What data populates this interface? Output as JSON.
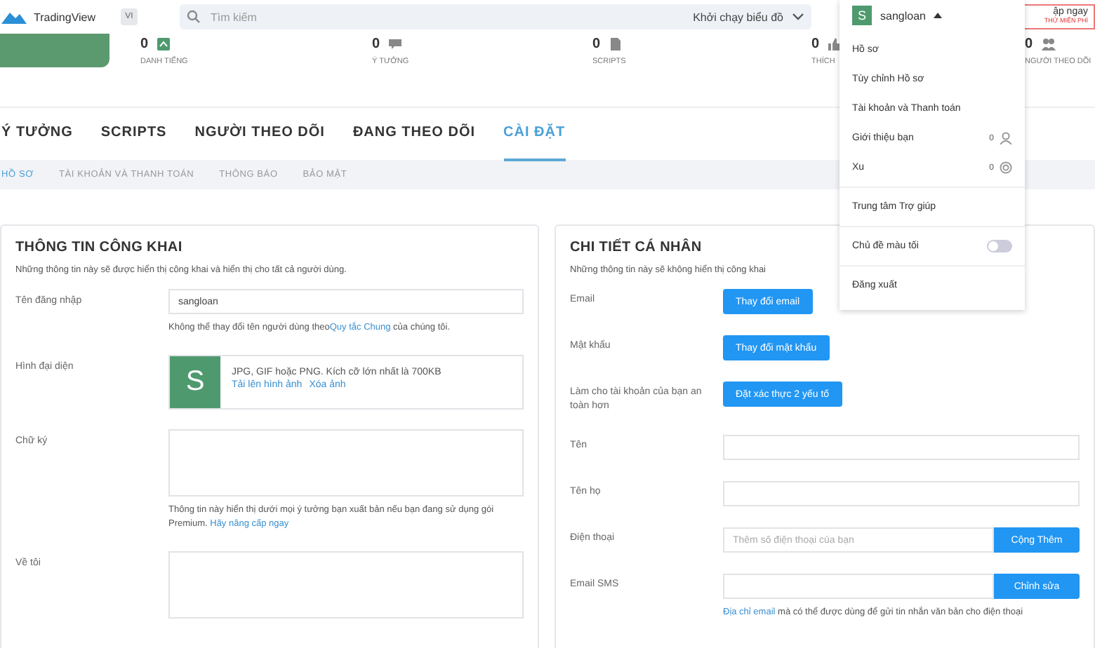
{
  "header": {
    "logo": "TradingView",
    "language": "VI",
    "search_placeholder": "Tìm kiếm",
    "launch_button": "Khởi chạy biểu đồ",
    "upgrade": {
      "label": "ập ngay",
      "sub": "THỬ MIỄN PHÍ"
    }
  },
  "stats": [
    {
      "value": "0",
      "label": "DANH TIẾNG"
    },
    {
      "value": "0",
      "label": "Ý TƯỞNG"
    },
    {
      "value": "0",
      "label": "SCRIPTS"
    },
    {
      "value": "0",
      "label": "THÍCH"
    },
    {
      "value": "0",
      "label": "NGƯỜI THEO DÕI"
    }
  ],
  "tabs": [
    {
      "label": "Ý TƯỞNG",
      "selected": false
    },
    {
      "label": "SCRIPTS",
      "selected": false
    },
    {
      "label": "NGƯỜI THEO DÕI",
      "selected": false
    },
    {
      "label": "ĐANG THEO DÕI",
      "selected": false
    },
    {
      "label": "CÀI ĐẶT",
      "selected": true
    }
  ],
  "subtabs": [
    {
      "label": "HỒ SƠ",
      "selected": true
    },
    {
      "label": "TÀI KHOẢN VÀ THANH TOÁN",
      "selected": false
    },
    {
      "label": "THÔNG BÁO",
      "selected": false
    },
    {
      "label": "BẢO MẬT",
      "selected": false
    }
  ],
  "public_info": {
    "title": "THÔNG TIN CÔNG KHAI",
    "description": "Những thông tin này sẽ được hiển thị công khai và hiển thị cho tất cả người dùng.",
    "username": {
      "label": "Tên đăng nhập",
      "value": "sangloan",
      "hint_before": "Không thể thay đổi tên người dùng theo",
      "hint_link": "Quy tắc Chung",
      "hint_after": " của chúng tôi."
    },
    "avatar": {
      "label": "Hình đại diện",
      "initial": "S",
      "note": "JPG, GIF hoặc PNG. Kích cỡ lớn nhất là 700KB",
      "upload_link": "Tải lên hình ảnh",
      "delete_link": "Xóa ảnh"
    },
    "signature": {
      "label": "Chữ ký",
      "hint": "Thông tin này hiển thị dưới mọi ý tưởng bạn xuất bản nếu bạn đang sử dụng gói Premium.",
      "hint_link": "Hãy nâng cấp ngay"
    },
    "about": {
      "label": "Về tôi"
    }
  },
  "personal": {
    "title": "CHI TIẾT CÁ NHÂN",
    "description": "Những thông tin này sẽ không hiển thị công khai",
    "rows": [
      {
        "kind": "button",
        "label": "Email",
        "button": "Thay đổi email"
      },
      {
        "kind": "button",
        "label": "Mật khẩu",
        "button": "Thay đổi mật khẩu"
      },
      {
        "kind": "button",
        "label": "Làm cho tài khoản của bạn an toàn hơn",
        "button": "Đặt xác thực 2 yếu tố"
      },
      {
        "kind": "input",
        "label": "Tên"
      },
      {
        "kind": "input",
        "label": "Tên họ"
      },
      {
        "kind": "input_button",
        "label": "Điện thoại",
        "placeholder": "Thêm số điện thoại của bạn",
        "button": "Cộng Thêm"
      },
      {
        "kind": "input_button",
        "label": "Email SMS",
        "button": "Chỉnh sửa",
        "hint_link": "Địa chỉ email",
        "hint": " mà có thể được dùng để gửi tin nhắn văn bản cho điện thoại"
      }
    ]
  },
  "menu": {
    "user": "sangloan",
    "initial": "S",
    "groups": [
      [
        {
          "kind": "link",
          "label": "Hồ sơ"
        },
        {
          "kind": "link",
          "label": "Tùy chỉnh Hồ sơ"
        },
        {
          "kind": "link",
          "label": "Tài khoản và Thanh toán"
        },
        {
          "kind": "count",
          "label": "Giới thiệu bạn",
          "count": "0"
        },
        {
          "kind": "count",
          "label": "Xu",
          "count": "0"
        }
      ],
      [
        {
          "kind": "link",
          "label": "Trung tâm Trợ giúp"
        }
      ],
      [
        {
          "kind": "toggle",
          "label": "Chủ đề màu tối",
          "on": false
        }
      ],
      [
        {
          "kind": "link",
          "label": "Đăng xuất"
        }
      ]
    ]
  }
}
